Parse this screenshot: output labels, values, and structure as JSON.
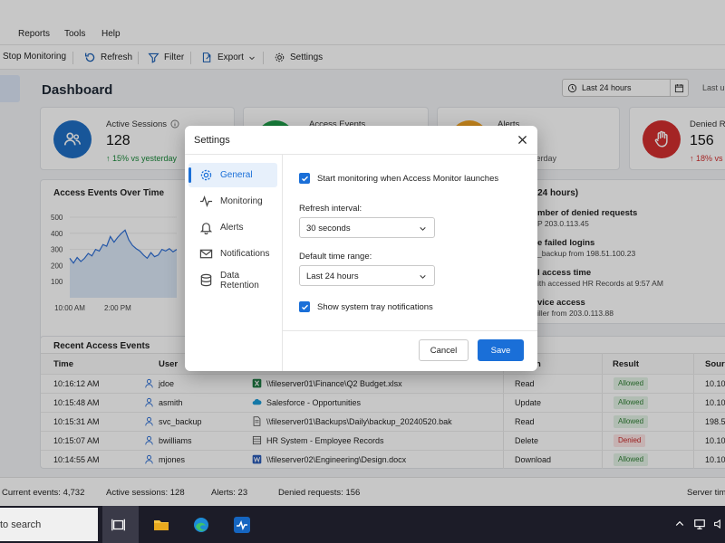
{
  "menu": [
    "Reports",
    "Tools",
    "Help"
  ],
  "toolbar": {
    "stop_monitoring": "Stop Monitoring",
    "refresh": "Refresh",
    "filter": "Filter",
    "export": "Export",
    "settings": "Settings"
  },
  "dashboard": {
    "title": "Dashboard",
    "range": "Last 24 hours",
    "last_updated": "Last up"
  },
  "kpis": [
    {
      "label": "Active Sessions",
      "value": "128",
      "trend": "↑ 15% vs yesterday",
      "color": "#1f6fc5",
      "icon": "users-icon"
    },
    {
      "label": "Access Events",
      "color": "#1e9e4a",
      "icon": "activity-icon"
    },
    {
      "label": "Alerts",
      "trend": "yesterday",
      "color": "#f5a623",
      "icon": "alert-icon"
    },
    {
      "label": "Denied R",
      "value": "156",
      "trend": "↑ 18% vs",
      "color": "#d32f2f",
      "icon": "hand-icon"
    }
  ],
  "chart": {
    "title": "Access Events Over Time",
    "yticks": [
      "500",
      "400",
      "300",
      "200",
      "100"
    ],
    "xticks": [
      "10:00 AM",
      "2:00 PM"
    ]
  },
  "chart_data": {
    "type": "area",
    "title": "Access Events Over Time",
    "xlabel": "",
    "ylabel": "",
    "ylim": [
      0,
      500
    ],
    "x": [
      "10:00 AM",
      "",
      "",
      "",
      "",
      "",
      "",
      "",
      "",
      "",
      "",
      "",
      "",
      "2:00 PM",
      "",
      "",
      "",
      "",
      "",
      "",
      "",
      "",
      "",
      "",
      "",
      "",
      "",
      "",
      "",
      ""
    ],
    "series": [
      {
        "values": [
          245,
          215,
          250,
          225,
          245,
          275,
          260,
          300,
          290,
          330,
          320,
          380,
          345,
          375,
          400,
          420,
          360,
          325,
          305,
          290,
          265,
          245,
          280,
          255,
          265,
          300,
          290,
          305,
          285,
          300
        ]
      }
    ],
    "color": "#2d6fd6"
  },
  "panel_right": {
    "title": "t 24 hours)",
    "items": [
      {
        "title": "mber of denied requests",
        "sub": "P 203.0.113.45"
      },
      {
        "title": "e failed logins",
        "sub": "_backup from 198.51.100.23"
      },
      {
        "title": "l access time",
        "sub": "ith accessed HR Records at 9:57 AM"
      },
      {
        "title": "vice access",
        "sub": "iller from 203.0.113.88"
      }
    ]
  },
  "table": {
    "title": "Recent Access Events",
    "headers": {
      "time": "Time",
      "user": "User",
      "action": "n",
      "result": "Result",
      "source": "Sour"
    },
    "rows": [
      {
        "time": "10:16:12 AM",
        "user": "jdoe",
        "resource": "\\\\fileserver01\\Finance\\Q2 Budget.xlsx",
        "res_icon": "excel-icon",
        "action": "Read",
        "result": "Allowed",
        "source": "10.10"
      },
      {
        "time": "10:15:48 AM",
        "user": "asmith",
        "resource": "Salesforce - Opportunities",
        "res_icon": "cloud-icon",
        "action": "Update",
        "result": "Allowed",
        "source": "10.10"
      },
      {
        "time": "10:15:31 AM",
        "user": "svc_backup",
        "resource": "\\\\fileserver01\\Backups\\Daily\\backup_20240520.bak",
        "res_icon": "file-icon",
        "action": "Read",
        "result": "Allowed",
        "source": "198.5"
      },
      {
        "time": "10:15:07 AM",
        "user": "bwilliams",
        "resource": "HR System - Employee Records",
        "res_icon": "database-icon",
        "action": "Delete",
        "result": "Denied",
        "source": "10.10"
      },
      {
        "time": "10:14:55 AM",
        "user": "mjones",
        "resource": "\\\\fileserver02\\Engineering\\Design.docx",
        "res_icon": "word-icon",
        "action": "Download",
        "result": "Allowed",
        "source": "10.10"
      }
    ]
  },
  "statusbar": {
    "current_events": "Current events: 4,732",
    "active_sessions": "Active sessions: 128",
    "alerts": "Alerts: 23",
    "denied": "Denied requests: 156",
    "server_time": "Server tim"
  },
  "taskbar": {
    "search": "to search"
  },
  "modal": {
    "title": "Settings",
    "nav": [
      "General",
      "Monitoring",
      "Alerts",
      "Notifications",
      "Data Retention"
    ],
    "start_monitoring": "Start monitoring when Access Monitor launches",
    "refresh_label": "Refresh interval:",
    "refresh_value": "30 seconds",
    "range_label": "Default time range:",
    "range_value": "Last 24 hours",
    "tray": "Show system tray notifications",
    "cancel": "Cancel",
    "save": "Save"
  }
}
